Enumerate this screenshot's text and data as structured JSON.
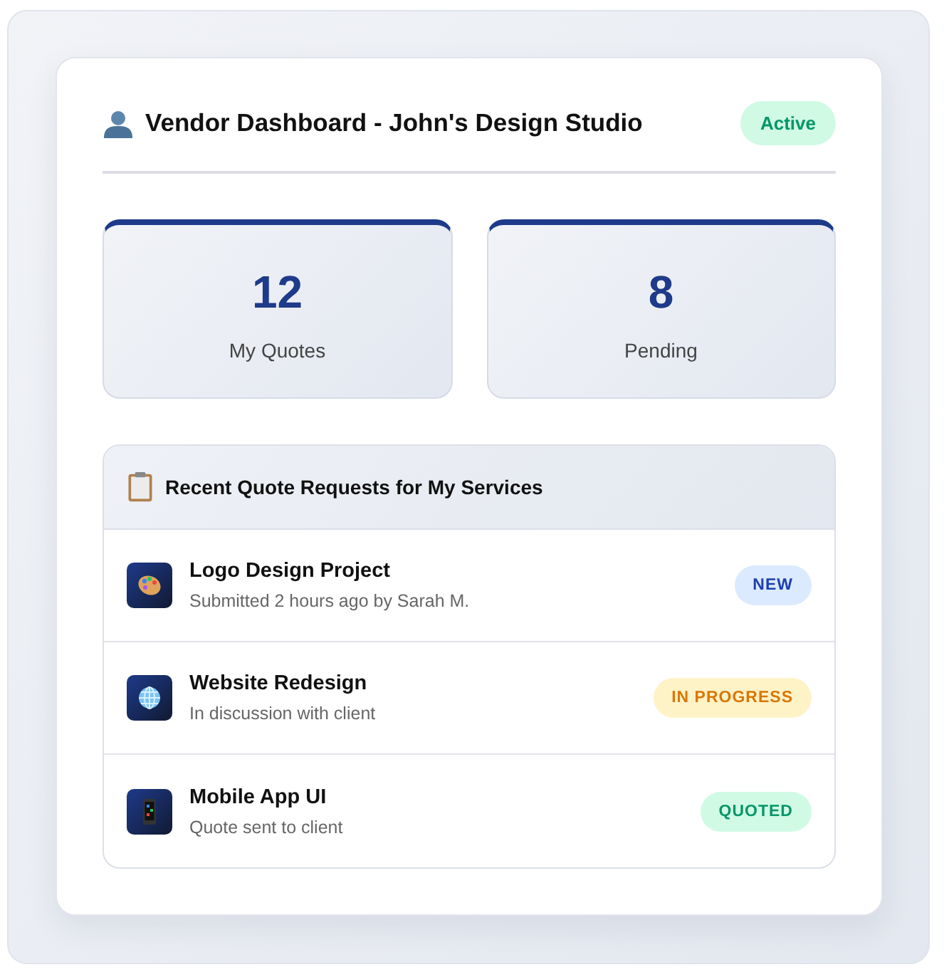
{
  "header": {
    "title": "Vendor Dashboard - John's Design Studio",
    "status": {
      "label": "Active",
      "kind": "active"
    }
  },
  "stats": [
    {
      "value": "12",
      "label": "My Quotes"
    },
    {
      "value": "8",
      "label": "Pending"
    }
  ],
  "requests": {
    "title": "Recent Quote Requests for My Services",
    "items": [
      {
        "kind": "palette",
        "title": "Logo Design Project",
        "subtitle": "Submitted 2 hours ago by Sarah M.",
        "status": {
          "label": "NEW",
          "kind": "new"
        }
      },
      {
        "kind": "globe",
        "title": "Website Redesign",
        "subtitle": "In discussion with client",
        "status": {
          "label": "IN PROGRESS",
          "kind": "progress"
        }
      },
      {
        "kind": "phone",
        "title": "Mobile App UI",
        "subtitle": "Quote sent to client",
        "status": {
          "label": "QUOTED",
          "kind": "quoted"
        }
      }
    ]
  }
}
